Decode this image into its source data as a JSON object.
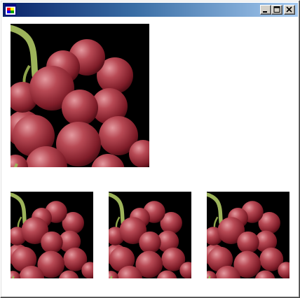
{
  "window": {
    "title": "",
    "controls": [
      "minimize-icon",
      "maximize-icon",
      "close-icon"
    ],
    "title_gradient": [
      "#0a246a",
      "#a6caf0"
    ]
  },
  "images": {
    "subject": "grapes-image",
    "colors": {
      "grape": "#a8313e",
      "highlight": "#d97a82",
      "stem": "#8fa84a",
      "background": "#000000"
    }
  }
}
